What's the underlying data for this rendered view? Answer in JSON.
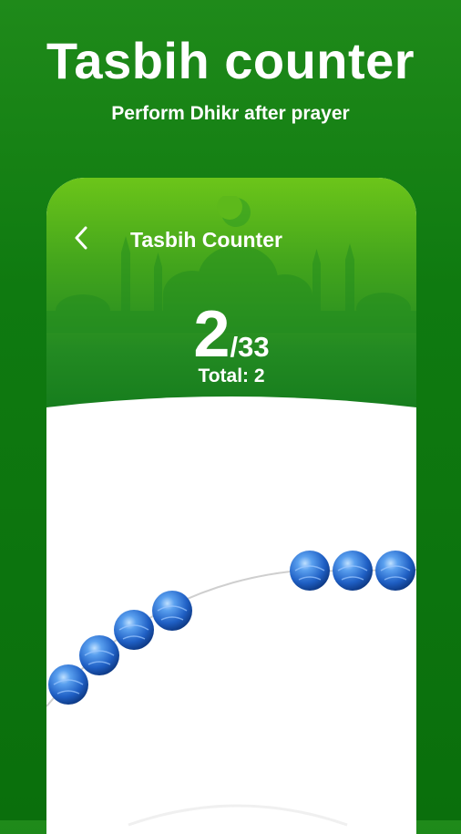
{
  "promo": {
    "title": "Tasbih counter",
    "subtitle": "Perform Dhikr after prayer"
  },
  "screen": {
    "title": "Tasbih Counter",
    "back_icon": "chevron-left-icon"
  },
  "counter": {
    "current": "2",
    "target": "/33",
    "total_label": "Total: 2"
  },
  "colors": {
    "background": "#0f7a10",
    "header_top": "#6cc51a",
    "header_bottom": "#137a1c",
    "bead": "#2f74d8"
  },
  "beads": {
    "moved_count": 3,
    "remaining_count": 4
  }
}
